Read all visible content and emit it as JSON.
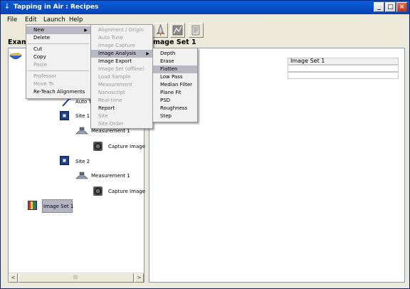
{
  "window": {
    "title": "Tapping in Air : Recipes",
    "controls": [
      "_",
      "□",
      "×"
    ]
  },
  "menubar": [
    "File",
    "Edit",
    "Launch",
    "Help"
  ],
  "left_header": "Exam",
  "right_header": "mage Set 1",
  "tree": [
    {
      "label": "Auto T",
      "icon": "probe-icon"
    },
    {
      "label": "Site 1",
      "icon": "site-icon"
    },
    {
      "label": "Measurement 1",
      "icon": "measurement-icon"
    },
    {
      "label": "Capture Image",
      "icon": "camera-icon"
    },
    {
      "label": "Site 2",
      "icon": "site-icon"
    },
    {
      "label": "Measurement 1",
      "icon": "measurement-icon"
    },
    {
      "label": "Capture Image",
      "icon": "camera-icon"
    },
    {
      "label": "Image Set 1",
      "icon": "image-set-icon"
    }
  ],
  "grid": {
    "header": "Image Set 1",
    "rows": [
      "",
      ""
    ]
  },
  "edit_menu": {
    "items": [
      {
        "label": "New",
        "submenu": true
      },
      {
        "label": "Delete"
      },
      {
        "label": "Cut"
      },
      {
        "label": "Copy"
      },
      {
        "label": "Paste",
        "disabled": true
      },
      {
        "label": "Professor",
        "disabled": true
      },
      {
        "label": "Move To",
        "disabled": true
      },
      {
        "label": "Re-Teach Alignments"
      }
    ]
  },
  "new_menu": {
    "items": [
      {
        "label": "Alignment / Origin",
        "disabled": true
      },
      {
        "label": "Auto Tune",
        "disabled": true
      },
      {
        "label": "Image Capture",
        "disabled": true
      },
      {
        "label": "Image Analysis",
        "submenu": true
      },
      {
        "label": "Image Export"
      },
      {
        "label": "Image Set (offline)",
        "disabled": true
      },
      {
        "label": "Load Sample",
        "disabled": true
      },
      {
        "label": "Measurement",
        "disabled": true
      },
      {
        "label": "Nanoscript",
        "disabled": true
      },
      {
        "label": "Real-time",
        "disabled": true
      },
      {
        "label": "Report"
      },
      {
        "label": "Site",
        "disabled": true
      },
      {
        "label": "Site Order",
        "disabled": true
      }
    ]
  },
  "analysis_menu": {
    "items": [
      "Depth",
      "Erase",
      "Flatten",
      "Low Pass",
      "Median Filter",
      "Plane Fit",
      "PSD",
      "Roughness",
      "Step"
    ],
    "highlighted": "Flatten"
  },
  "scrollbar": {
    "left": "<",
    "right": ">",
    "thumb": "|||"
  }
}
